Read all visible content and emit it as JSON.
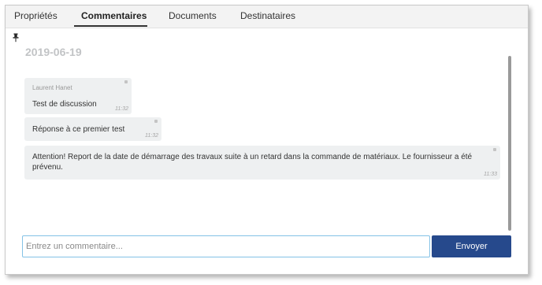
{
  "tabs": [
    {
      "label": "Propriétés",
      "active": false
    },
    {
      "label": "Commentaires",
      "active": true
    },
    {
      "label": "Documents",
      "active": false
    },
    {
      "label": "Destinataires",
      "active": false
    }
  ],
  "content": {
    "pinned": true,
    "date_header": "2019-06-19",
    "messages": [
      {
        "author": "Laurent Hanet",
        "text": "Test de discussion",
        "time": "11:32"
      },
      {
        "text": "Réponse à ce premier test",
        "time": "11:32"
      },
      {
        "text": "Attention! Report de la date de démarrage des travaux suite à un retard dans la commande de matériaux. Le fournisseur a été prévenu.",
        "time": "11:33"
      }
    ]
  },
  "composer": {
    "placeholder": "Entrez un commentaire...",
    "value": "",
    "send_label": "Envoyer"
  },
  "colors": {
    "accent": "#26498c",
    "bubble": "#eef0f1",
    "date_header": "#c2c4c6",
    "input_focus_border": "#84c2e6"
  }
}
